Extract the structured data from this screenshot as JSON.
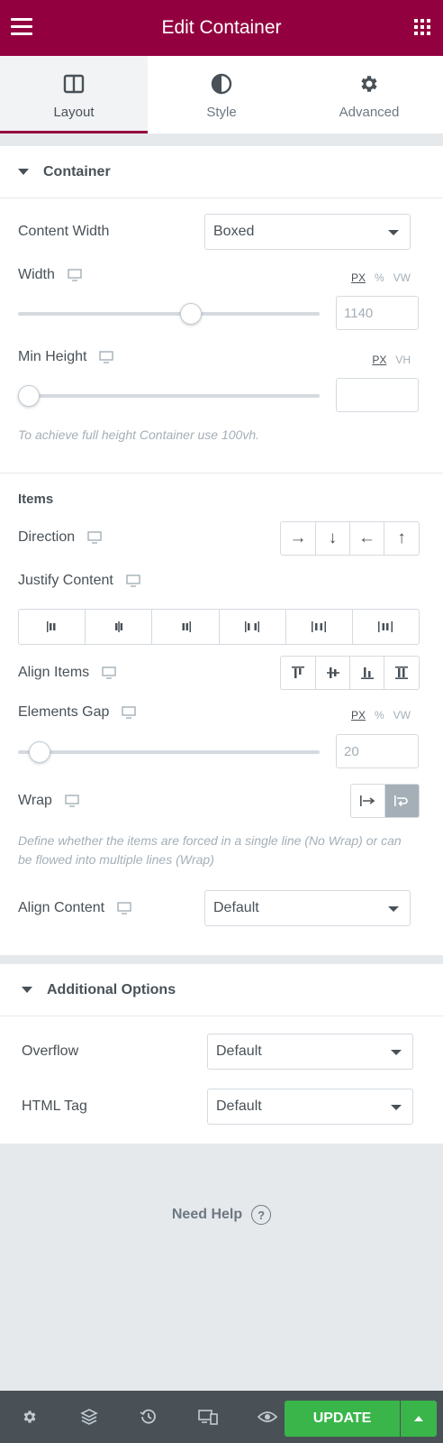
{
  "header": {
    "title": "Edit Container",
    "menu_icon": "hamburger-icon",
    "apps_icon": "grid-icon",
    "color": "#93003f"
  },
  "tabs": [
    {
      "label": "Layout",
      "icon": "columns-icon",
      "active": true
    },
    {
      "label": "Style",
      "icon": "half-circle-icon",
      "active": false
    },
    {
      "label": "Advanced",
      "icon": "gear-icon",
      "active": false
    }
  ],
  "container_section": {
    "title": "Container",
    "content_width": {
      "label": "Content Width",
      "value": "Boxed"
    },
    "width": {
      "label": "Width",
      "units": [
        "PX",
        "%",
        "VW"
      ],
      "active_unit": "PX",
      "value": "1140",
      "slider_fraction": 0.58
    },
    "min_height": {
      "label": "Min Height",
      "units": [
        "PX",
        "VH"
      ],
      "active_unit": "PX",
      "value": "",
      "slider_fraction": 0.0
    },
    "note": "To achieve full height Container use 100vh."
  },
  "items_section": {
    "title": "Items",
    "direction": {
      "label": "Direction",
      "options": [
        "→",
        "↓",
        "←",
        "↑"
      ]
    },
    "justify_content": {
      "label": "Justify Content"
    },
    "align_items": {
      "label": "Align Items"
    },
    "elements_gap": {
      "label": "Elements Gap",
      "units": [
        "PX",
        "%",
        "VW"
      ],
      "active_unit": "PX",
      "value": "20",
      "slider_fraction": 0.04
    },
    "wrap": {
      "label": "Wrap",
      "selected": "wrap",
      "note": "Define whether the items are forced in a single line (No Wrap) or can be flowed into multiple lines (Wrap)"
    },
    "align_content": {
      "label": "Align Content",
      "value": "Default"
    }
  },
  "additional_section": {
    "title": "Additional Options",
    "overflow": {
      "label": "Overflow",
      "value": "Default"
    },
    "html_tag": {
      "label": "HTML Tag",
      "value": "Default"
    }
  },
  "help": {
    "label": "Need Help",
    "icon": "question-circle-icon"
  },
  "footer": {
    "icons": [
      "settings-icon",
      "layers-icon",
      "history-icon",
      "responsive-icon",
      "preview-icon"
    ],
    "update_label": "UPDATE",
    "update_color": "#39b54a"
  }
}
